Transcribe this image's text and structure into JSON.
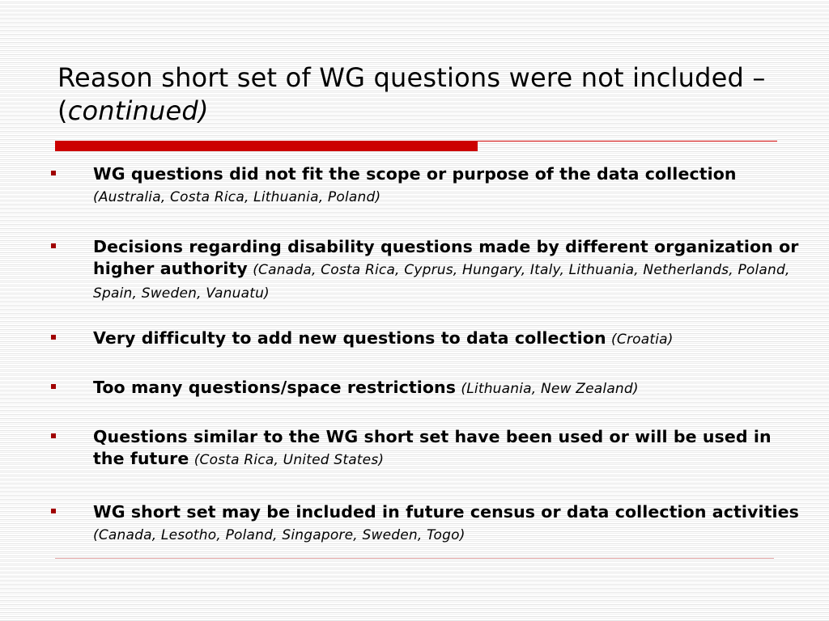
{
  "slide": {
    "title_main": "Reason short set of WG questions were not included –",
    "title_open_paren": "(",
    "title_italic": "continued)",
    "accent_color": "#cc0000",
    "items": [
      {
        "text": "WG questions did not fit the scope or purpose of the data collection",
        "countries": "(Australia, Costa Rica, Lithuania, Poland)"
      },
      {
        "text": "Decisions regarding disability questions made by different organization or higher authority",
        "countries": "(Canada, Costa Rica, Cyprus, Hungary, Italy, Lithuania, Netherlands, Poland, Spain, Sweden, Vanuatu)"
      },
      {
        "text": "Very difficulty to add new questions to data collection",
        "countries": "(Croatia)"
      },
      {
        "text": "Too many questions/space restrictions",
        "countries": "(Lithuania, New Zealand)"
      },
      {
        "text": "Questions similar to the WG short set have been used or will be used in the future",
        "countries": "(Costa Rica, United States)"
      },
      {
        "text": "WG short set may be included in future census or data collection activities",
        "countries": "(Canada, Lesotho, Poland, Singapore, Sweden, Togo)"
      }
    ]
  }
}
